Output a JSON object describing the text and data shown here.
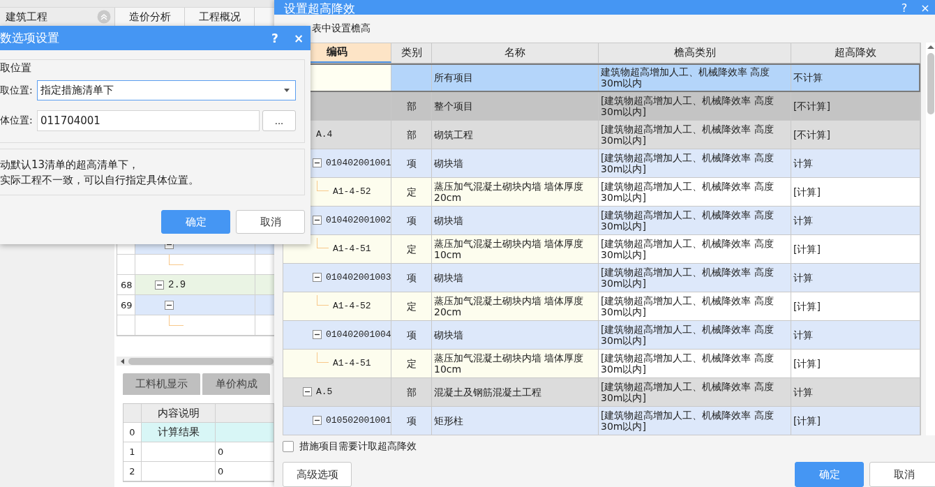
{
  "app": {
    "tree_label": "建筑工程",
    "header_tabs": [
      {
        "label": "造价分析"
      },
      {
        "label": "工程概况"
      }
    ],
    "tree_rows": [
      {
        "kind": "item",
        "expanded": true,
        "children": [
          {
            "kind": "quota"
          }
        ]
      },
      {
        "number": "68",
        "kind": "section",
        "code": "2.9",
        "expanded": true,
        "children": [
          {
            "number": "69",
            "kind": "item",
            "expanded": true,
            "children": [
              {
                "kind": "quota"
              }
            ]
          }
        ]
      }
    ],
    "bottom_tabs": [
      {
        "label": "工料机显示"
      },
      {
        "label": "单价构成"
      }
    ],
    "detail_table": {
      "columns": [
        "内容说明"
      ],
      "rows": [
        {
          "number": "0",
          "description": "计算结果",
          "kind": "summary"
        },
        {
          "number": "1",
          "value": "0",
          "kind": "normal"
        },
        {
          "number": "2",
          "value": "0",
          "kind": "normal"
        }
      ]
    }
  },
  "height_dialog": {
    "title": "设置超高降效",
    "help": "?",
    "close": "×",
    "caption": "表中设置檐高",
    "columns": [
      {
        "label": "编码",
        "selected": true
      },
      {
        "label": "类别",
        "selected": false
      },
      {
        "label": "名称",
        "selected": false
      },
      {
        "label": "檐高类别",
        "selected": false
      },
      {
        "label": "超高降效",
        "selected": false
      }
    ],
    "rows": [
      {
        "kind": "all",
        "name": "所有项目",
        "height_class": "建筑物超高增加人工、机械降效率 高度30m以内",
        "reduction": "不计算",
        "selected": true
      },
      {
        "kind": "part",
        "category": "部",
        "name": "整个项目",
        "height_class": "[建筑物超高增加人工、机械降效率 高度30m以内]",
        "reduction": "[不计算]",
        "selected": false,
        "children": [
          {
            "kind": "part",
            "code": "A.4",
            "category": "部",
            "name": "砌筑工程",
            "height_class": "[建筑物超高增加人工、机械降效率 高度30m以内]",
            "reduction": "[不计算]",
            "selected": false,
            "children": [
              {
                "kind": "item",
                "code": "010402001001",
                "category": "项",
                "name": "砌块墙",
                "height_class": "[建筑物超高增加人工、机械降效率 高度30m以内]",
                "reduction": "计算",
                "selected": false,
                "expanded": true,
                "children": [
                  {
                    "kind": "quota",
                    "code": "A1-4-52",
                    "category": "定",
                    "name": "蒸压加气混凝土砌块内墙 墙体厚度20cm",
                    "height_class": "[建筑物超高增加人工、机械降效率 高度30m以内]",
                    "reduction": "[计算]",
                    "selected": false
                  }
                ]
              },
              {
                "kind": "item",
                "code": "010402001002",
                "category": "项",
                "name": "砌块墙",
                "height_class": "[建筑物超高增加人工、机械降效率 高度30m以内]",
                "reduction": "计算",
                "selected": false,
                "expanded": true,
                "children": [
                  {
                    "kind": "quota",
                    "code": "A1-4-51",
                    "category": "定",
                    "name": "蒸压加气混凝土砌块内墙 墙体厚度10cm",
                    "height_class": "[建筑物超高增加人工、机械降效率 高度30m以内]",
                    "reduction": "[计算]",
                    "selected": false
                  }
                ]
              },
              {
                "kind": "item",
                "code": "010402001003",
                "category": "项",
                "name": "砌块墙",
                "height_class": "[建筑物超高增加人工、机械降效率 高度30m以内]",
                "reduction": "计算",
                "selected": false,
                "expanded": true,
                "children": [
                  {
                    "kind": "quota",
                    "code": "A1-4-52",
                    "category": "定",
                    "name": "蒸压加气混凝土砌块内墙 墙体厚度20cm",
                    "height_class": "[建筑物超高增加人工、机械降效率 高度30m以内]",
                    "reduction": "[计算]",
                    "selected": false
                  }
                ]
              },
              {
                "kind": "item",
                "code": "010402001004",
                "category": "项",
                "name": "砌块墙",
                "height_class": "[建筑物超高增加人工、机械降效率 高度30m以内]",
                "reduction": "计算",
                "selected": false,
                "expanded": true,
                "children": [
                  {
                    "kind": "quota",
                    "code": "A1-4-51",
                    "category": "定",
                    "name": "蒸压加气混凝土砌块内墙 墙体厚度10cm",
                    "height_class": "[建筑物超高增加人工、机械降效率 高度30m以内]",
                    "reduction": "[计算]",
                    "selected": false
                  }
                ]
              }
            ]
          },
          {
            "kind": "part",
            "code": "A.5",
            "category": "部",
            "name": "混凝土及钢筋混凝土工程",
            "height_class": "[建筑物超高增加人工、机械降效率 高度30m以内]",
            "reduction": "计算",
            "selected": false,
            "expanded": true,
            "children": [
              {
                "kind": "item",
                "code": "010502001001",
                "category": "项",
                "name": "矩形柱",
                "height_class": "[建筑物超高增加人工、机械降效率 高度30m以内]",
                "reduction": "[计算]",
                "selected": false,
                "expanded": true
              }
            ]
          }
        ]
      }
    ],
    "checkbox": {
      "label": "措施项目需要计取超高降效",
      "checked": false
    },
    "extra_button": {
      "label": "高级选项"
    },
    "buttons": [
      {
        "label": "确定",
        "kind": "primary"
      },
      {
        "label": "取消",
        "kind": "secondary"
      }
    ]
  },
  "options_dialog": {
    "title": "数选项设置",
    "help": "?",
    "close": "×",
    "group_label": "取位置",
    "fields": [
      {
        "label": "取位置:",
        "kind": "dropdown",
        "value": "指定措施清单下"
      },
      {
        "label": "体位置:",
        "kind": "browse",
        "value": "011704001",
        "button": "..."
      }
    ],
    "notes": [
      "动默认13清单的超高清单下，",
      "实际工程不一致，可以自行指定具体位置。"
    ],
    "buttons": [
      {
        "label": "确定",
        "kind": "primary"
      },
      {
        "label": "取消",
        "kind": "secondary"
      }
    ]
  }
}
